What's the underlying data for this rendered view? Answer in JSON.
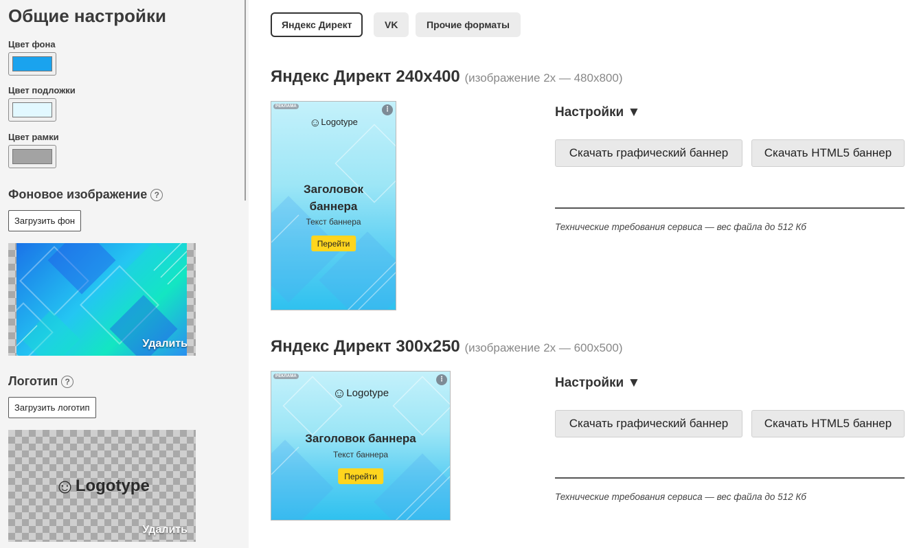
{
  "sidebar": {
    "title": "Общие настройки",
    "bg_color": {
      "label": "Цвет фона",
      "value": "#1aa3ee"
    },
    "underlay_color": {
      "label": "Цвет подложки",
      "value": "#e2f8ff"
    },
    "frame_color": {
      "label": "Цвет рамки",
      "value": "#a3a3a3"
    },
    "bg_image": {
      "title": "Фоновое изображение",
      "help": "?",
      "upload": "Загрузить фон",
      "delete": "Удалить"
    },
    "logo": {
      "title": "Логотип",
      "help": "?",
      "upload": "Загрузить логотип",
      "delete": "Удалить",
      "preview_text": "Logotype",
      "preview_icon": "smiley-icon"
    }
  },
  "tabs": [
    {
      "label": "Яндекс Директ",
      "active": true
    },
    {
      "label": "VK",
      "active": false
    },
    {
      "label": "Прочие форматы",
      "active": false
    }
  ],
  "formats": [
    {
      "title": "Яндекс Директ 240x400",
      "subtitle": "(изображение 2x — 480x800)",
      "banner": {
        "ad_label": "РЕКЛАМА",
        "menu_icon": "more-vertical-icon",
        "logo": "Logotype",
        "heading": "Заголовок баннера",
        "text": "Текст баннера",
        "button": "Перейти"
      },
      "settings": "Настройки ▼",
      "download_graphic": "Скачать графический баннер",
      "download_html5": "Скачать HTML5 баннер",
      "requirements": "Технические требования сервиса — вес файла до 512 Кб"
    },
    {
      "title": "Яндекс Директ 300x250",
      "subtitle": "(изображение 2x — 600x500)",
      "banner": {
        "ad_label": "РЕКЛАМА",
        "menu_icon": "more-vertical-icon",
        "logo": "Logotype",
        "heading": "Заголовок баннера",
        "text": "Текст баннера",
        "button": "Перейти"
      },
      "settings": "Настройки ▼",
      "download_graphic": "Скачать графический баннер",
      "download_html5": "Скачать HTML5 баннер",
      "requirements": "Технические требования сервиса — вес файла до 512 Кб"
    }
  ]
}
